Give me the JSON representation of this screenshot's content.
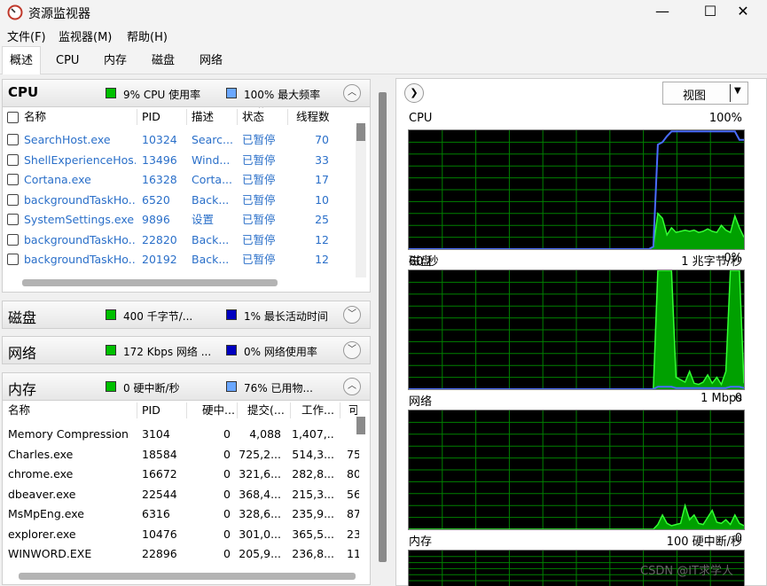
{
  "window": {
    "title": "资源监视器",
    "minimize": "—",
    "maximize": "☐",
    "close": "✕"
  },
  "menu": [
    "文件(F)",
    "监视器(M)",
    "帮助(H)"
  ],
  "tabs": [
    "概述",
    "CPU",
    "内存",
    "磁盘",
    "网络"
  ],
  "cpu": {
    "title": "CPU",
    "stat1": "9% CPU 使用率",
    "stat2": "100% 最大频率",
    "stat1_color": "#00c000",
    "stat2_color": "#6aa7ff",
    "columns": [
      "名称",
      "PID",
      "描述",
      "状态",
      "线程数"
    ],
    "rows": [
      {
        "name": "SearchHost.exe",
        "pid": "10324",
        "desc": "Searc...",
        "status": "已暂停",
        "threads": "70"
      },
      {
        "name": "ShellExperienceHos...",
        "pid": "13496",
        "desc": "Wind...",
        "status": "已暂停",
        "threads": "33"
      },
      {
        "name": "Cortana.exe",
        "pid": "16328",
        "desc": "Corta...",
        "status": "已暂停",
        "threads": "17"
      },
      {
        "name": "backgroundTaskHo...",
        "pid": "6520",
        "desc": "Back...",
        "status": "已暂停",
        "threads": "10"
      },
      {
        "name": "SystemSettings.exe",
        "pid": "9896",
        "desc": "设置",
        "status": "已暂停",
        "threads": "25"
      },
      {
        "name": "backgroundTaskHo...",
        "pid": "22820",
        "desc": "Back...",
        "status": "已暂停",
        "threads": "12"
      },
      {
        "name": "backgroundTaskHo...",
        "pid": "20192",
        "desc": "Back...",
        "status": "已暂停",
        "threads": "12"
      }
    ]
  },
  "disk": {
    "title": "磁盘",
    "stat1": "400 千字节/...",
    "stat2": "1% 最长活动时间",
    "stat1_color": "#00c000",
    "stat2_color": "#0000c0"
  },
  "network": {
    "title": "网络",
    "stat1": "172 Kbps 网络 ...",
    "stat2": "0% 网络使用率",
    "stat1_color": "#00c000",
    "stat2_color": "#0000c0"
  },
  "memory": {
    "title": "内存",
    "stat1": "0 硬中断/秒",
    "stat2": "76% 已用物...",
    "stat1_color": "#00c000",
    "stat2_color": "#6aa7ff",
    "columns": [
      "名称",
      "PID",
      "硬中...",
      "提交(...",
      "工作...",
      "可"
    ],
    "rows": [
      {
        "name": "Memory Compression",
        "pid": "3104",
        "hard": "0",
        "commit": "4,088",
        "working": "1,407,...",
        "extra": ""
      },
      {
        "name": "Charles.exe",
        "pid": "18584",
        "hard": "0",
        "commit": "725,2...",
        "working": "514,3...",
        "extra": "75"
      },
      {
        "name": "chrome.exe",
        "pid": "16672",
        "hard": "0",
        "commit": "321,6...",
        "working": "282,8...",
        "extra": "80"
      },
      {
        "name": "dbeaver.exe",
        "pid": "22544",
        "hard": "0",
        "commit": "368,4...",
        "working": "215,3...",
        "extra": "56"
      },
      {
        "name": "MsMpEng.exe",
        "pid": "6316",
        "hard": "0",
        "commit": "328,6...",
        "working": "235,9...",
        "extra": "87"
      },
      {
        "name": "explorer.exe",
        "pid": "10476",
        "hard": "0",
        "commit": "301,0...",
        "working": "365,5...",
        "extra": "23"
      },
      {
        "name": "WINWORD.EXE",
        "pid": "22896",
        "hard": "0",
        "commit": "205,9...",
        "working": "236,8...",
        "extra": "11"
      }
    ]
  },
  "right_panel": {
    "view_label": "视图",
    "graphs": [
      {
        "id": "cpu",
        "title": "CPU",
        "max": "100%",
        "foot_left": "60 秒",
        "foot_right": "0%",
        "green": [
          0,
          0,
          0,
          0,
          0,
          0,
          0,
          0,
          0,
          0,
          0,
          0,
          0,
          0,
          0,
          0,
          0,
          0,
          0,
          0,
          0,
          0,
          0,
          0,
          0,
          0,
          0,
          0,
          0,
          0,
          0,
          0,
          0,
          0,
          0,
          0,
          0,
          0,
          0,
          0,
          0,
          0,
          0,
          0,
          0,
          0,
          0,
          0,
          0,
          0,
          0,
          0,
          0,
          0,
          0.02,
          0.3,
          0.26,
          0.12,
          0.18,
          0.14,
          0.15,
          0.16,
          0.15,
          0.16,
          0.14,
          0.15,
          0.17,
          0.15,
          0.14,
          0.2,
          0.16,
          0.14,
          0.28,
          0.18,
          0.1
        ],
        "blue": [
          0,
          0,
          0,
          0,
          0,
          0,
          0,
          0,
          0,
          0,
          0,
          0,
          0,
          0,
          0,
          0,
          0,
          0,
          0,
          0,
          0,
          0,
          0,
          0,
          0,
          0,
          0,
          0,
          0,
          0,
          0,
          0,
          0,
          0,
          0,
          0,
          0,
          0,
          0,
          0,
          0,
          0,
          0,
          0,
          0,
          0,
          0,
          0,
          0,
          0,
          0,
          0,
          0,
          0,
          0.02,
          0.88,
          0.9,
          0.95,
          0.99,
          0.99,
          0.99,
          0.99,
          0.99,
          0.99,
          0.99,
          0.99,
          0.99,
          0.99,
          0.99,
          0.99,
          0.99,
          0.99,
          0.99,
          0.92,
          0.92
        ]
      },
      {
        "id": "disk",
        "title": "磁盘",
        "max": "1 兆字节/秒",
        "foot_left": "",
        "foot_right": "0",
        "green": [
          0,
          0,
          0,
          0,
          0,
          0,
          0,
          0,
          0,
          0,
          0,
          0,
          0,
          0,
          0,
          0,
          0,
          0,
          0,
          0,
          0,
          0,
          0,
          0,
          0,
          0,
          0,
          0,
          0,
          0,
          0,
          0,
          0,
          0,
          0,
          0,
          0,
          0,
          0,
          0,
          0,
          0,
          0,
          0,
          0,
          0,
          0,
          0,
          0,
          0,
          0,
          0,
          0,
          0,
          0,
          1,
          1,
          1,
          1,
          0.1,
          0.08,
          0.06,
          0.15,
          0.05,
          0.04,
          0.06,
          0.12,
          0.05,
          0.1,
          0.04,
          0.15,
          1,
          1,
          1,
          0.05
        ],
        "blue": [
          0,
          0,
          0,
          0,
          0,
          0,
          0,
          0,
          0,
          0,
          0,
          0,
          0,
          0,
          0,
          0,
          0,
          0,
          0,
          0,
          0,
          0,
          0,
          0,
          0,
          0,
          0,
          0,
          0,
          0,
          0,
          0,
          0,
          0,
          0,
          0,
          0,
          0,
          0,
          0,
          0,
          0,
          0,
          0,
          0,
          0,
          0,
          0,
          0,
          0,
          0,
          0,
          0,
          0,
          0,
          0.02,
          0.02,
          0.02,
          0.02,
          0.01,
          0.01,
          0.01,
          0.01,
          0.01,
          0.01,
          0.01,
          0.01,
          0.01,
          0.01,
          0.01,
          0.01,
          0.02,
          0.02,
          0.02,
          0.01
        ]
      },
      {
        "id": "network",
        "title": "网络",
        "max": "1 Mbps",
        "foot_left": "",
        "foot_right": "0",
        "green": [
          0,
          0,
          0,
          0,
          0,
          0,
          0,
          0,
          0,
          0,
          0,
          0,
          0,
          0,
          0,
          0,
          0,
          0,
          0,
          0,
          0,
          0,
          0,
          0,
          0,
          0,
          0,
          0,
          0,
          0,
          0,
          0,
          0,
          0,
          0,
          0,
          0,
          0,
          0,
          0,
          0,
          0,
          0,
          0,
          0,
          0,
          0,
          0,
          0,
          0,
          0,
          0,
          0,
          0,
          0,
          0.04,
          0.12,
          0.05,
          0.03,
          0.04,
          0.05,
          0.2,
          0.08,
          0.12,
          0.05,
          0.04,
          0.1,
          0.16,
          0.06,
          0.05,
          0.08,
          0.04,
          0.12,
          0.05,
          0.03
        ],
        "blue": []
      },
      {
        "id": "memory",
        "title": "内存",
        "max": "100 硬中断/秒",
        "foot_left": "",
        "foot_right": "",
        "green": [],
        "blue": []
      }
    ]
  },
  "watermark": "CSDN @IT求学人"
}
